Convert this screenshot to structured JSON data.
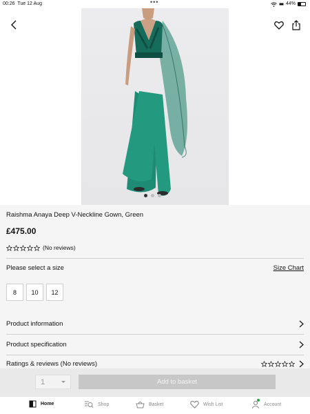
{
  "status_bar": {
    "time": "00:26",
    "date": "Tue 12 Aug",
    "battery": "44%"
  },
  "product": {
    "title": "Raishma Anaya Deep V-Neckline Gown, Green",
    "price": "£475.00",
    "reviews_text": "(No reviews)",
    "rating_stars": 0,
    "image_count": 3,
    "active_image": 1,
    "dress_color": "#1f8a73"
  },
  "size_section": {
    "label": "Please select a size",
    "chart_link": "Size Chart",
    "sizes": [
      "8",
      "10",
      "12"
    ]
  },
  "accordion": {
    "product_information": "Product information",
    "product_specification": "Product specification",
    "ratings_reviews": "Ratings & reviews (No reviews)"
  },
  "purchase": {
    "quantity": "1",
    "add_to_basket": "Add to basket"
  },
  "tabs": {
    "home": "Home",
    "shop": "Shop",
    "basket": "Basket",
    "wishlist": "Wish List",
    "account": "Account"
  }
}
